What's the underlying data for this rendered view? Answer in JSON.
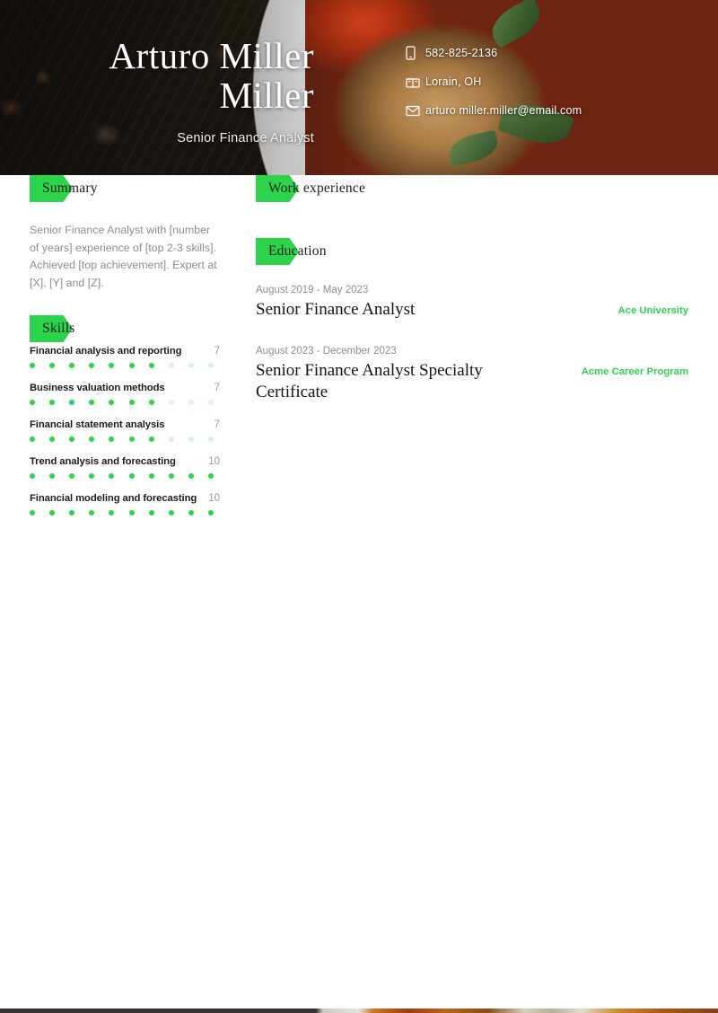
{
  "header": {
    "name_line1": "Arturo Miller",
    "name_line2": "Miller",
    "job_title": "Senior Finance Analyst",
    "contacts": [
      {
        "icon": "phone-icon",
        "value": "582-825-2136"
      },
      {
        "icon": "location-icon",
        "value": "Lorain, OH"
      },
      {
        "icon": "email-icon",
        "value": "arturo miller.miller@email.com"
      }
    ]
  },
  "left_column": {
    "summary": {
      "heading": "Summary",
      "text": "Senior Finance Analyst with [number of years] experience of [top 2-3 skills]. Achieved [top achievement]. Expert at [X], [Y] and [Z]."
    },
    "skills": {
      "heading": "Skills",
      "max": 10,
      "items": [
        {
          "name": "Financial analysis and reporting",
          "score": 7
        },
        {
          "name": "Business valuation methods",
          "score": 7
        },
        {
          "name": "Financial statement analysis",
          "score": 7
        },
        {
          "name": "Trend analysis and forecasting",
          "score": 10
        },
        {
          "name": "Financial modeling and forecasting",
          "score": 10
        }
      ]
    }
  },
  "right_column": {
    "work_experience": {
      "heading": "Work experience",
      "items": []
    },
    "education": {
      "heading": "Education",
      "items": [
        {
          "dates": "August 2019 - May 2023",
          "degree": "Senior Finance Analyst",
          "organization": "Ace University"
        },
        {
          "dates": "August 2023 - December 2023",
          "degree": "Senior Finance Analyst Specialty Certificate",
          "organization": "Acme Career Program"
        }
      ]
    }
  },
  "theme": {
    "accent_green": "#2bd44a",
    "accent_green_faded": "#d6f5dd",
    "text_dark": "#1c1c1c",
    "text_muted": "#8d8d8d"
  }
}
